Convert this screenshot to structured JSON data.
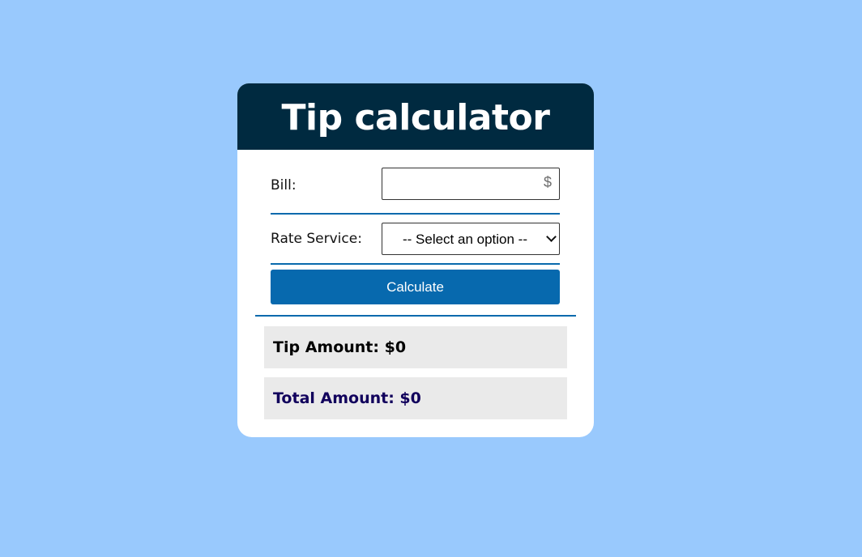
{
  "app": {
    "title": "Tip calculator"
  },
  "form": {
    "bill_label": "Bill:",
    "bill_value": "",
    "bill_currency_symbol": "$",
    "rate_label": "Rate Service:",
    "rate_selected": "-- Select an option --",
    "calculate_label": "Calculate"
  },
  "results": {
    "tip_text": "Tip Amount: $0",
    "total_text": "Total Amount: $0"
  },
  "colors": {
    "background": "#99c9fd",
    "header": "#002a40",
    "accent": "#0769ae",
    "total_text": "#11005c",
    "result_bg": "#eaeaea"
  },
  "icons": {
    "dropdown": "chevron-down-icon"
  }
}
